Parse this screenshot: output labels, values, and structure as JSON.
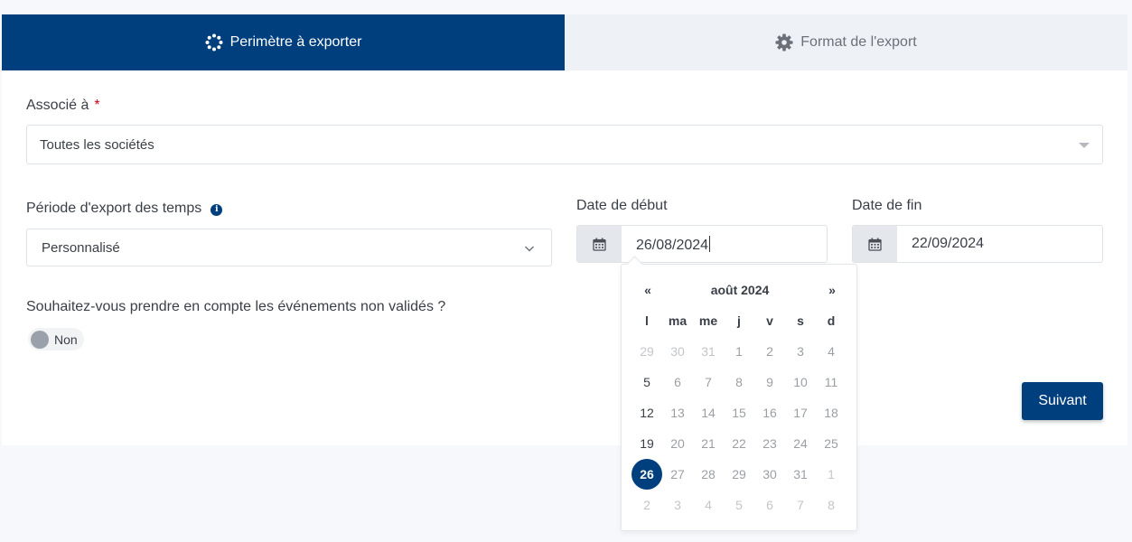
{
  "tabs": {
    "perimeter": "Perimètre à exporter",
    "format": "Format de l'export"
  },
  "form": {
    "associe_label": "Associé à",
    "required_mark": "*",
    "associe_value": "Toutes les sociétés",
    "periode_label": "Période d'export des temps",
    "info_icon": "i",
    "periode_value": "Personnalisé",
    "date_debut_label": "Date de début",
    "date_debut_value": "26/08/2024",
    "date_fin_label": "Date de fin",
    "date_fin_value": "22/09/2024",
    "evenements_label": "Souhaitez-vous prendre en compte les événements non validés ?",
    "toggle_label": "Non",
    "toggle_on": false,
    "next_button": "Suivant"
  },
  "datepicker": {
    "prev": "«",
    "title": "août 2024",
    "next": "»",
    "weekdays": [
      "l",
      "ma",
      "me",
      "j",
      "v",
      "s",
      "d"
    ],
    "weeks": [
      [
        {
          "d": "29",
          "t": "dim"
        },
        {
          "d": "30",
          "t": "dim"
        },
        {
          "d": "31",
          "t": "dim"
        },
        {
          "d": "1",
          "t": "n"
        },
        {
          "d": "2",
          "t": "n"
        },
        {
          "d": "3",
          "t": "n"
        },
        {
          "d": "4",
          "t": "n"
        }
      ],
      [
        {
          "d": "5",
          "t": "strong"
        },
        {
          "d": "6",
          "t": "n"
        },
        {
          "d": "7",
          "t": "n"
        },
        {
          "d": "8",
          "t": "n"
        },
        {
          "d": "9",
          "t": "n"
        },
        {
          "d": "10",
          "t": "n"
        },
        {
          "d": "11",
          "t": "n"
        }
      ],
      [
        {
          "d": "12",
          "t": "strong"
        },
        {
          "d": "13",
          "t": "n"
        },
        {
          "d": "14",
          "t": "n"
        },
        {
          "d": "15",
          "t": "n"
        },
        {
          "d": "16",
          "t": "n"
        },
        {
          "d": "17",
          "t": "n"
        },
        {
          "d": "18",
          "t": "n"
        }
      ],
      [
        {
          "d": "19",
          "t": "strong"
        },
        {
          "d": "20",
          "t": "n"
        },
        {
          "d": "21",
          "t": "n"
        },
        {
          "d": "22",
          "t": "n"
        },
        {
          "d": "23",
          "t": "n"
        },
        {
          "d": "24",
          "t": "n"
        },
        {
          "d": "25",
          "t": "n"
        }
      ],
      [
        {
          "d": "26",
          "t": "sel"
        },
        {
          "d": "27",
          "t": "n"
        },
        {
          "d": "28",
          "t": "n"
        },
        {
          "d": "29",
          "t": "n"
        },
        {
          "d": "30",
          "t": "n"
        },
        {
          "d": "31",
          "t": "n"
        },
        {
          "d": "1",
          "t": "dim"
        }
      ],
      [
        {
          "d": "2",
          "t": "dim"
        },
        {
          "d": "3",
          "t": "dim"
        },
        {
          "d": "4",
          "t": "dim"
        },
        {
          "d": "5",
          "t": "dim"
        },
        {
          "d": "6",
          "t": "dim"
        },
        {
          "d": "7",
          "t": "dim"
        },
        {
          "d": "8",
          "t": "dim"
        }
      ]
    ]
  },
  "colors": {
    "primary": "#003f7d",
    "required": "#d0021b",
    "tab_inactive_bg": "#eef1f5"
  },
  "icons": {
    "perimeter_tab": "spinner-dots-icon",
    "format_tab": "gear-icon",
    "associe_caret": "caret-down-icon",
    "periode_chevron": "chevron-down-icon",
    "date_debut": "calendar-icon",
    "date_fin": "calendar-icon"
  }
}
